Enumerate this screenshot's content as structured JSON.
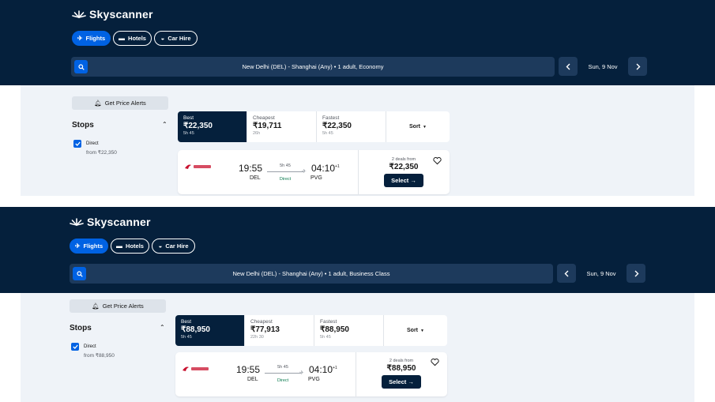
{
  "brand": {
    "name": "Skyscanner"
  },
  "chips": {
    "flights": "Flights",
    "hotels": "Hotels",
    "car_hire": "Car Hire"
  },
  "alerts_label": "Get Price Alerts",
  "stops": {
    "title": "Stops",
    "option_label": "Direct"
  },
  "tabs": {
    "best": "Best",
    "cheapest": "Cheapest",
    "fastest": "Fastest",
    "sort": "Sort"
  },
  "select_label": "Select →",
  "panels": [
    {
      "search_text": "New Delhi (DEL) - Shanghai (Any)  •  1 adult, Economy",
      "date": "Sun, 9 Nov",
      "stops_from": "from ₹22,350",
      "best": {
        "price": "₹22,350",
        "duration": "5h 45"
      },
      "cheapest": {
        "price": "₹19,711",
        "duration": "26h"
      },
      "fastest": {
        "price": "₹22,350",
        "duration": "5h 45"
      },
      "flight": {
        "depart_time": "19:55",
        "depart_code": "DEL",
        "arrive_time": "04:10",
        "arrive_plus": "+1",
        "arrive_code": "PVG",
        "duration": "5h 45",
        "stops": "Direct",
        "deals": "2 deals from",
        "price": "₹22,350"
      }
    },
    {
      "search_text": "New Delhi (DEL) - Shanghai (Any)  •  1 adult, Business Class",
      "date": "Sun, 9 Nov",
      "stops_from": "from ₹88,950",
      "best": {
        "price": "₹88,950",
        "duration": "5h 45"
      },
      "cheapest": {
        "price": "₹77,913",
        "duration": "22h 30"
      },
      "fastest": {
        "price": "₹88,950",
        "duration": "5h 45"
      },
      "flight": {
        "depart_time": "19:55",
        "depart_code": "DEL",
        "arrive_time": "04:10",
        "arrive_plus": "+1",
        "arrive_code": "PVG",
        "duration": "5h 45",
        "stops": "Direct",
        "deals": "2 deals from",
        "price": "₹88,950"
      }
    }
  ],
  "colors": {
    "navy": "#05203c",
    "blue": "#0062e3",
    "green": "#0b7a4f",
    "content_bg": "#eff3f8"
  }
}
